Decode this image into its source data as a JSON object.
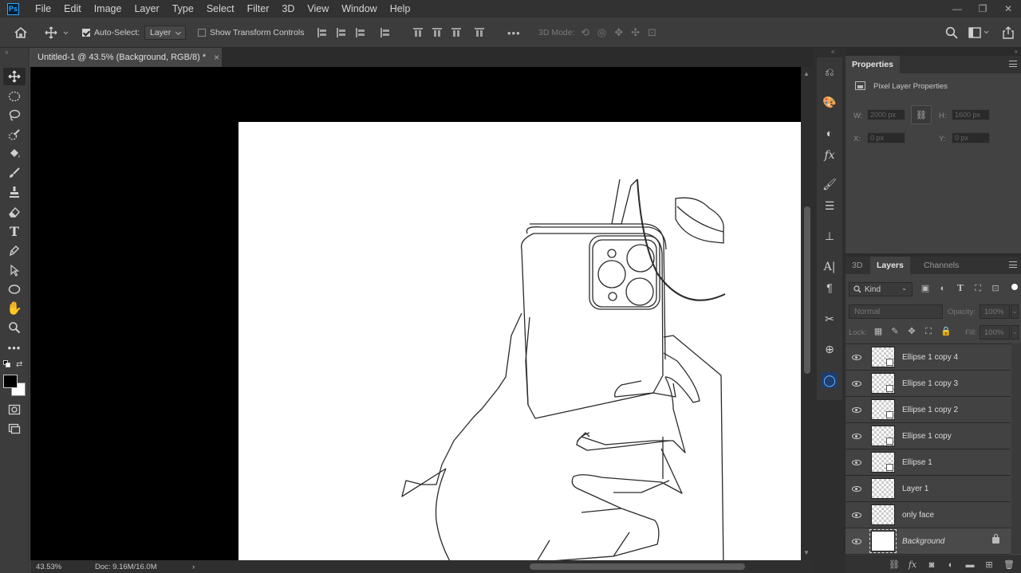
{
  "app": {
    "logo": "Ps",
    "menu": [
      "File",
      "Edit",
      "Image",
      "Layer",
      "Type",
      "Select",
      "Filter",
      "3D",
      "View",
      "Window",
      "Help"
    ],
    "window_controls": [
      "—",
      "❐",
      "✕"
    ]
  },
  "options_bar": {
    "auto_select_label": "Auto-Select:",
    "auto_select_checked": true,
    "auto_select_target": "Layer",
    "show_transform_label": "Show Transform Controls",
    "show_transform_checked": false,
    "more": "•••",
    "mode_3d_label": "3D Mode:"
  },
  "document": {
    "tab_title": "Untitled-1 @ 43.5% (Background, RGB/8) *",
    "close": "×",
    "zoom": "43.53%",
    "doc_info": "Doc: 9.16M/16.0M",
    "arrow": "›"
  },
  "properties": {
    "tab_label": "Properties",
    "section_title": "Pixel Layer Properties",
    "w_label": "W:",
    "w_value": "2000 px",
    "h_label": "H:",
    "h_value": "1600 px",
    "x_label": "X:",
    "x_value": "0 px",
    "y_label": "Y:",
    "y_value": "0 px"
  },
  "layers_panel": {
    "tabs": [
      "3D",
      "Layers",
      "Channels"
    ],
    "active_tab": "Layers",
    "filter_kind": "Kind",
    "blend_mode": "Normal",
    "opacity_label": "Opacity:",
    "opacity_value": "100%",
    "lock_label": "Lock:",
    "fill_label": "Fill:",
    "fill_value": "100%",
    "layers": [
      {
        "name": "Ellipse 1 copy 4",
        "smart": true
      },
      {
        "name": "Ellipse 1 copy 3",
        "smart": true
      },
      {
        "name": "Ellipse 1 copy 2",
        "smart": true
      },
      {
        "name": "Ellipse 1 copy",
        "smart": true
      },
      {
        "name": "Ellipse 1",
        "smart": true
      },
      {
        "name": "Layer 1",
        "smart": false
      },
      {
        "name": "only face",
        "smart": false
      },
      {
        "name": "Background",
        "smart": false,
        "locked": true,
        "selected": true
      }
    ],
    "footer_icons": [
      "link-icon",
      "fx-icon",
      "mask-icon",
      "adjustment-icon",
      "folder-icon",
      "new-layer-icon",
      "trash-icon"
    ]
  },
  "colors": {
    "accent": "#31a8ff",
    "foreground": "#000000",
    "background": "#ffffff"
  }
}
